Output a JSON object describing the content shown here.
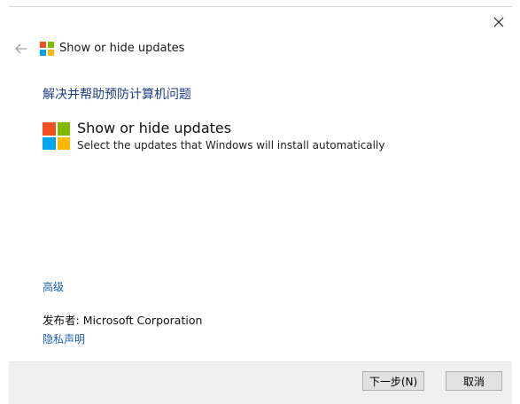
{
  "window": {
    "title": "Show or hide updates",
    "close_glyph": "✕",
    "back_glyph": "←"
  },
  "main": {
    "heading": "解决并帮助预防计算机问题",
    "option": {
      "title": "Show or hide updates",
      "description": "Select the updates that Windows will install automatically",
      "icon": "windows-logo-icon"
    },
    "advanced_link": "高级",
    "publisher_label": "发布者:",
    "publisher_value": "Microsoft Corporation",
    "privacy_link": "隐私声明"
  },
  "footer": {
    "next_button": "下一步(N)",
    "cancel_button": "取消"
  },
  "colors": {
    "logo_red": "#f25022",
    "logo_green": "#7fba00",
    "logo_blue": "#00a4ef",
    "logo_yellow": "#ffb900",
    "link": "#1a5fb4",
    "heading": "#1e3e8a"
  }
}
